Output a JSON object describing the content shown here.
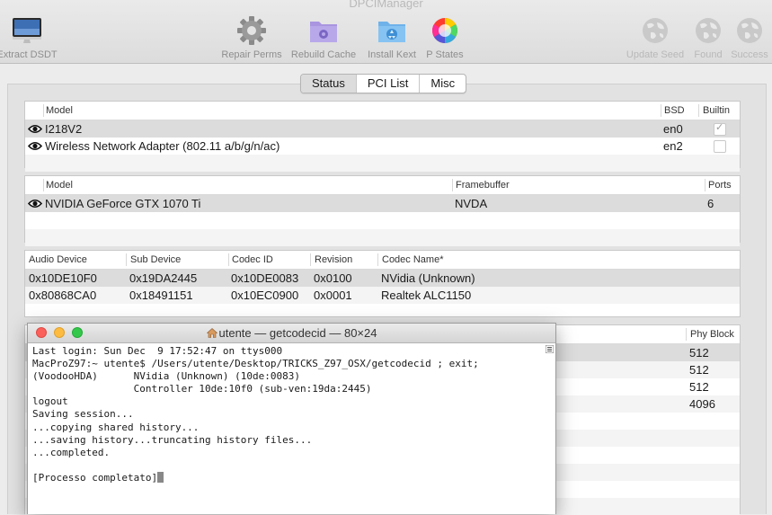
{
  "app": {
    "title": "DPCIManager"
  },
  "toolbar": {
    "extract_dsdt": "Extract DSDT",
    "repair_perms": "Repair Perms",
    "rebuild_cache": "Rebuild Cache",
    "install_kext": "Install Kext",
    "p_states": "P States",
    "update_seed": "Update Seed",
    "found": "Found",
    "success": "Success"
  },
  "tabs": [
    "Status",
    "PCI List",
    "Misc"
  ],
  "network": {
    "headers": {
      "model": "Model",
      "bsd": "BSD",
      "builtin": "Builtin"
    },
    "rows": [
      {
        "model": "I218V2",
        "bsd": "en0",
        "builtin": true
      },
      {
        "model": "Wireless Network Adapter (802.11 a/b/g/n/ac)",
        "bsd": "en2",
        "builtin": false
      }
    ]
  },
  "graphics": {
    "headers": {
      "model": "Model",
      "framebuffer": "Framebuffer",
      "ports": "Ports"
    },
    "rows": [
      {
        "model": "NVIDIA GeForce GTX 1070 Ti",
        "framebuffer": "NVDA",
        "ports": "6"
      }
    ]
  },
  "audio": {
    "headers": {
      "audio_device": "Audio Device",
      "sub_device": "Sub Device",
      "codec_id": "Codec ID",
      "revision": "Revision",
      "codec_name": "Codec Name*"
    },
    "rows": [
      {
        "audio_device": "0x10DE10F0",
        "sub_device": "0x19DA2445",
        "codec_id": "0x10DE0083",
        "revision": "0x0100",
        "codec_name": "NVidia (Unknown)"
      },
      {
        "audio_device": "0x80868CA0",
        "sub_device": "0x18491151",
        "codec_id": "0x10EC0900",
        "revision": "0x0001",
        "codec_name": "Realtek ALC1150"
      }
    ]
  },
  "storage": {
    "headers": {
      "phy_block": "Phy Block"
    },
    "phy_blocks": [
      "512",
      "512",
      "512",
      "4096"
    ]
  },
  "terminal": {
    "title": "utente — getcodecid — 80×24",
    "lines": [
      "Last login: Sun Dec  9 17:52:47 on ttys000",
      "MacProZ97:~ utente$ /Users/utente/Desktop/TRICKS_Z97_OSX/getcodecid ; exit;",
      "(VoodooHDA)      NVidia (Unknown) (10de:0083)",
      "                 Controller 10de:10f0 (sub-ven:19da:2445)",
      "logout",
      "Saving session...",
      "...copying shared history...",
      "...saving history...truncating history files...",
      "...completed.",
      "",
      "[Processo completato]"
    ]
  },
  "colors": {
    "close": "#fc605b",
    "minimize": "#fdbc40",
    "zoom": "#34c84a"
  }
}
